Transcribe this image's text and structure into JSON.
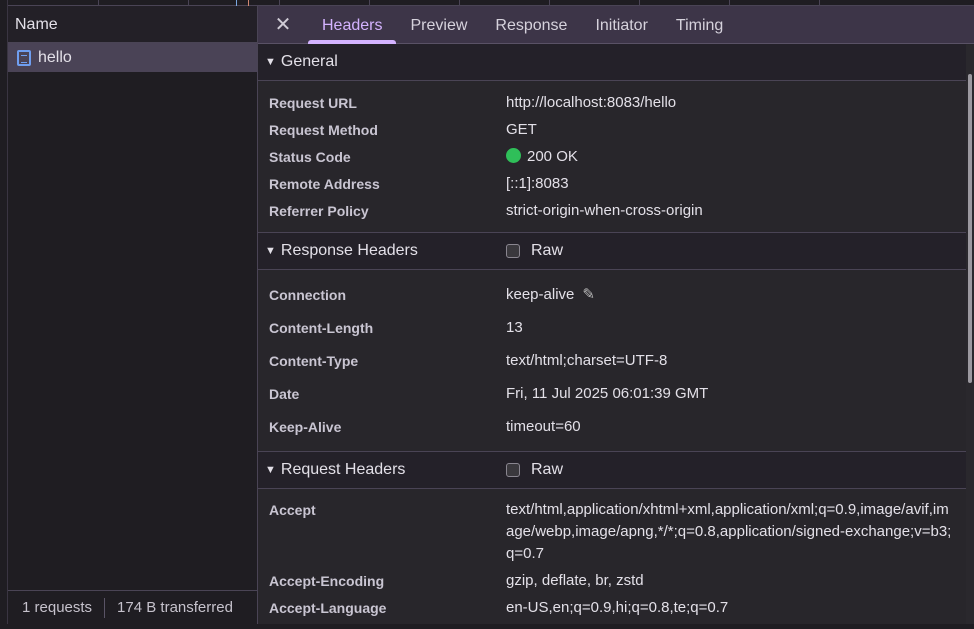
{
  "left": {
    "column_header": "Name",
    "requests": [
      {
        "name": "hello",
        "icon": "document-icon"
      }
    ],
    "footer": {
      "requests": "1 requests",
      "transferred": "174 B transferred"
    }
  },
  "tabs": [
    "Headers",
    "Preview",
    "Response",
    "Initiator",
    "Timing"
  ],
  "active_tab": "Headers",
  "general": {
    "title": "General",
    "rows": [
      {
        "k": "Request URL",
        "v": "http://localhost:8083/hello"
      },
      {
        "k": "Request Method",
        "v": "GET"
      },
      {
        "k": "Status Code",
        "v": "200 OK"
      },
      {
        "k": "Remote Address",
        "v": "[::1]:8083"
      },
      {
        "k": "Referrer Policy",
        "v": "strict-origin-when-cross-origin"
      }
    ]
  },
  "response_headers": {
    "title": "Response Headers",
    "raw_label": "Raw",
    "rows": [
      {
        "k": "Connection",
        "v": "keep-alive"
      },
      {
        "k": "Content-Length",
        "v": "13"
      },
      {
        "k": "Content-Type",
        "v": "text/html;charset=UTF-8"
      },
      {
        "k": "Date",
        "v": "Fri, 11 Jul 2025 06:01:39 GMT"
      },
      {
        "k": "Keep-Alive",
        "v": "timeout=60"
      }
    ]
  },
  "request_headers": {
    "title": "Request Headers",
    "raw_label": "Raw",
    "rows": [
      {
        "k": "Accept",
        "v": "text/html,application/xhtml+xml,application/xml;q=0.9,image/avif,image/webp,image/apng,*/*;q=0.8,application/signed-exchange;v=b3;q=0.7"
      },
      {
        "k": "Accept-Encoding",
        "v": "gzip, deflate, br, zstd"
      },
      {
        "k": "Accept-Language",
        "v": "en-US,en;q=0.9,hi;q=0.8,te;q=0.7"
      }
    ]
  },
  "colors": {
    "accent": "#d4b3ff",
    "status_ok": "#2fbf59"
  }
}
